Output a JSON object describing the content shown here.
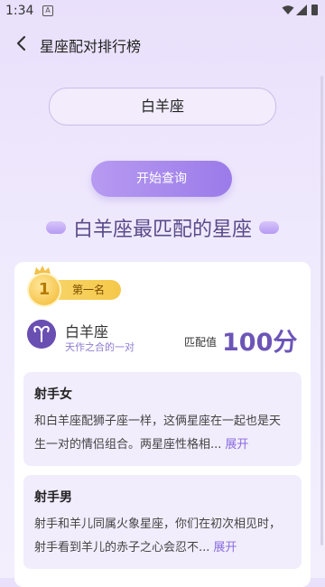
{
  "status_bar": {
    "time": "1:34",
    "notif_glyph": "A"
  },
  "header": {
    "title": "星座配对排行榜"
  },
  "selector": {
    "value": "白羊座"
  },
  "query_button": {
    "label": "开始查询"
  },
  "heading": {
    "text": "白羊座最匹配的星座"
  },
  "result": {
    "rank_number": "1",
    "rank_label": "第一名",
    "sign_name": "白羊座",
    "sign_subtitle": "天作之合的一对",
    "match_label": "匹配值",
    "match_value": "100分",
    "items": [
      {
        "name": "射手女",
        "desc": "和白羊座配狮子座一样，这俩星座在一起也是天生一对的情侣组合。两星座性格相...",
        "expand": "展开"
      },
      {
        "name": "射手男",
        "desc": "射手和羊儿同属火象星座，你们在初次相见时，射手看到羊儿的赤子之心会忍不...",
        "expand": "展开"
      }
    ]
  },
  "colors": {
    "accent": "#9b7be9",
    "brand": "#6c55b7",
    "background": "#efe9fd"
  },
  "icons": {
    "back": "chevron-left-icon",
    "wifi": "wifi-icon",
    "signal": "signal-icon",
    "battery": "battery-icon",
    "aries": "aries-icon"
  }
}
